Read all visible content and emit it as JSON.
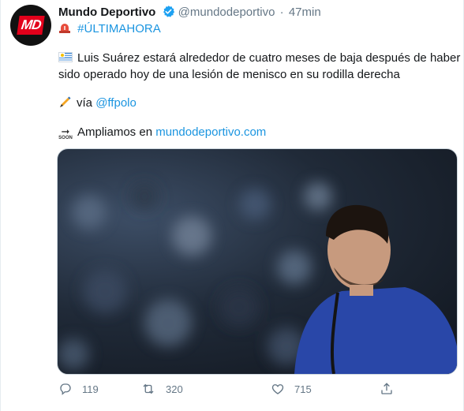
{
  "tweet": {
    "author_name": "Mundo Deportivo",
    "author_handle": "@mundodeportivo",
    "separator": "·",
    "time": "47min",
    "avatar_text": "MD",
    "hashtag": "#ÚLTIMAHORA",
    "line1": "Luis Suárez estará alrededor de cuatro meses de baja después de haber",
    "line2": "sido operado hoy de una lesión de menisco en su rodilla derecha",
    "via_prefix": "vía ",
    "via_mention": "@ffpolo",
    "ampliamos_prefix": "Ampliamos en ",
    "ampliamos_link": "mundodeportivo.com",
    "soon_label": "SOON",
    "icons": {
      "verified": "verified-badge-icon",
      "siren": "siren-icon",
      "flag": "uruguay-flag-icon",
      "pen": "writing-hand-icon",
      "soon": "soon-arrow-icon",
      "reply": "reply-icon",
      "retweet": "retweet-icon",
      "like": "heart-icon",
      "share": "share-icon"
    }
  },
  "actions": {
    "replies": "119",
    "retweets": "320",
    "likes": "715"
  },
  "colors": {
    "link": "#1b95e0",
    "secondary_text": "#657786",
    "brand_red": "#e3001b",
    "verified_blue": "#1da1f2"
  }
}
